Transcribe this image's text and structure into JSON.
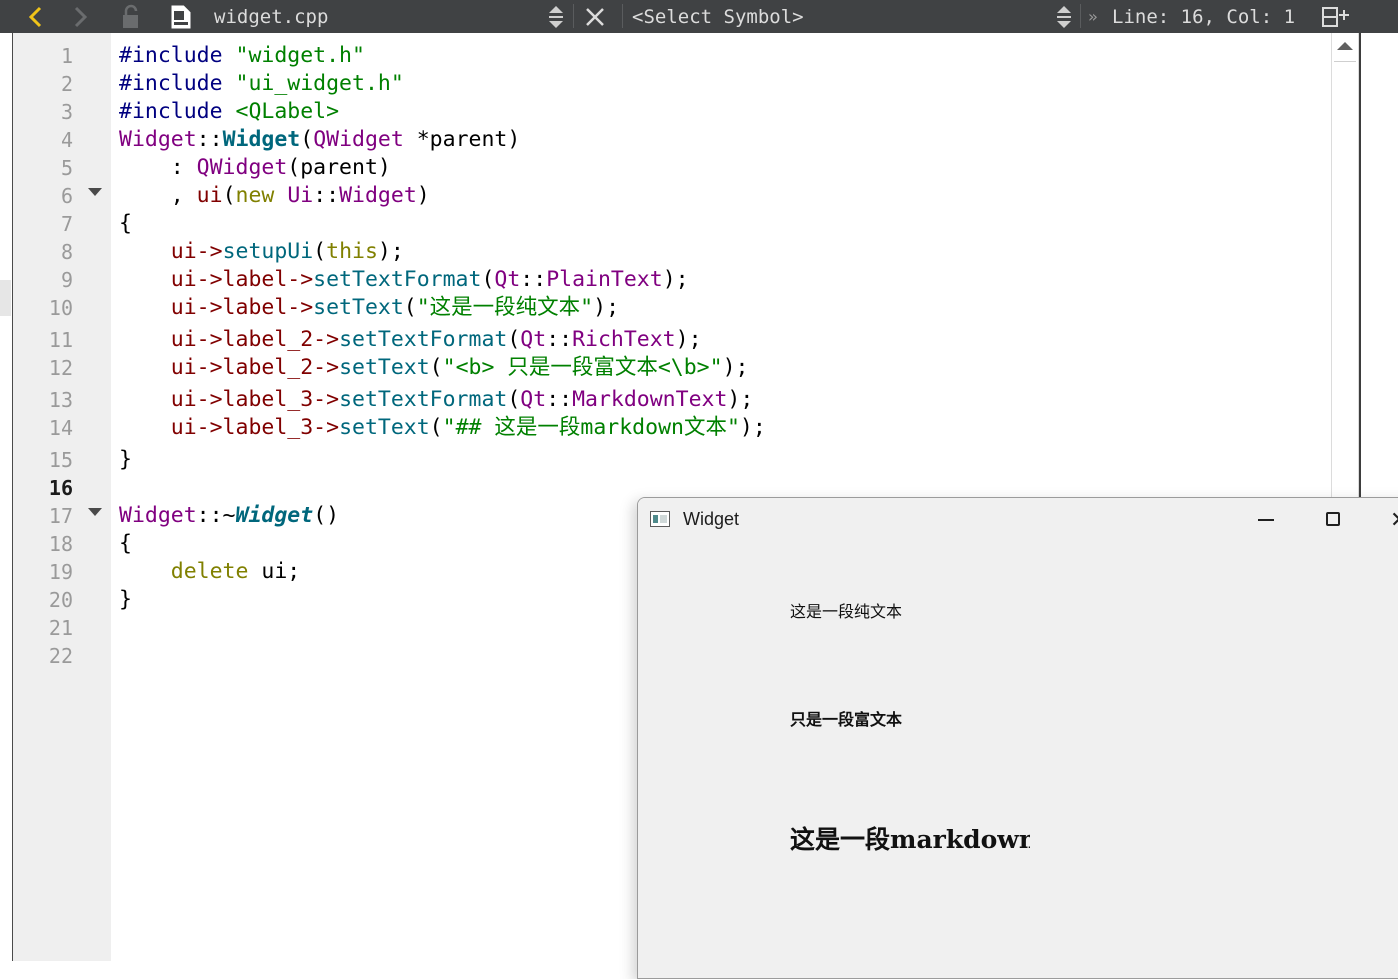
{
  "toolbar": {
    "file_name": "widget.cpp",
    "symbol_placeholder": "<Select Symbol>",
    "cursor_position": "Line: 16, Col: 1",
    "back_icon": "chevron-left-icon",
    "forward_icon": "chevron-right-icon",
    "lock_icon": "lock-icon",
    "file_icon": "document-icon",
    "close_icon": "close-icon",
    "split_icon": "split-view-icon",
    "accent_color": "#f0c419"
  },
  "editor": {
    "line_numbers": [
      "1",
      "2",
      "3",
      "4",
      "5",
      "6",
      "7",
      "8",
      "9",
      "10",
      "11",
      "12",
      "13",
      "14",
      "15",
      "16",
      "17",
      "18",
      "19",
      "20",
      "21",
      "22"
    ],
    "current_line": "16",
    "lines": {
      "l1_a": "#include ",
      "l1_b": "\"widget.h\"",
      "l2_a": "#include ",
      "l2_b": "\"ui_widget.h\"",
      "l3_a": "#include ",
      "l3_b": "<QLabel>",
      "l4_a": "Widget",
      "l4_b": "::",
      "l4_c": "Widget",
      "l4_d": "(",
      "l4_e": "QWidget",
      "l4_f": " *parent)",
      "l5_a": "    : ",
      "l5_b": "QWidget",
      "l5_c": "(parent)",
      "l6_a": "    , ",
      "l6_b": "ui",
      "l6_c": "(",
      "l6_d": "new",
      "l6_e": " ",
      "l6_f": "Ui",
      "l6_g": "::",
      "l6_h": "Widget",
      "l6_i": ")",
      "l7_a": "{",
      "l8_a": "    ui->",
      "l8_b": "setupUi",
      "l8_c": "(",
      "l8_d": "this",
      "l8_e": ");",
      "l9_a": "    ui->label->",
      "l9_b": "setTextFormat",
      "l9_c": "(",
      "l9_d": "Qt",
      "l9_e": "::",
      "l9_f": "PlainText",
      "l9_g": ");",
      "l10_a": "    ui->label->",
      "l10_b": "setText",
      "l10_c": "(",
      "l10_d": "\"这是一段纯文本\"",
      "l10_e": ");",
      "l11_a": "    ui->label_2->",
      "l11_b": "setTextFormat",
      "l11_c": "(",
      "l11_d": "Qt",
      "l11_e": "::",
      "l11_f": "RichText",
      "l11_g": ");",
      "l12_a": "    ui->label_2->",
      "l12_b": "setText",
      "l12_c": "(",
      "l12_d": "\"<b> 只是一段富文本<\\b>\"",
      "l12_e": ");",
      "l13_a": "    ui->label_3->",
      "l13_b": "setTextFormat",
      "l13_c": "(",
      "l13_d": "Qt",
      "l13_e": "::",
      "l13_f": "MarkdownText",
      "l13_g": ");",
      "l14_a": "    ui->label_3->",
      "l14_b": "setText",
      "l14_c": "(",
      "l14_d": "\"## 这是一段markdown文本\"",
      "l14_e": ");",
      "l15_a": "}",
      "l17_a": "Widget",
      "l17_b": "::~",
      "l17_c": "Widget",
      "l17_d": "()",
      "l18_a": "{",
      "l19_a": "    ",
      "l19_b": "delete",
      "l19_c": " ui;",
      "l20_a": "}"
    }
  },
  "popup": {
    "title": "Widget",
    "label_plain": "这是一段纯文本",
    "label_rich": "只是一段富文本",
    "label_markdown": "这是一段markdown文本"
  }
}
